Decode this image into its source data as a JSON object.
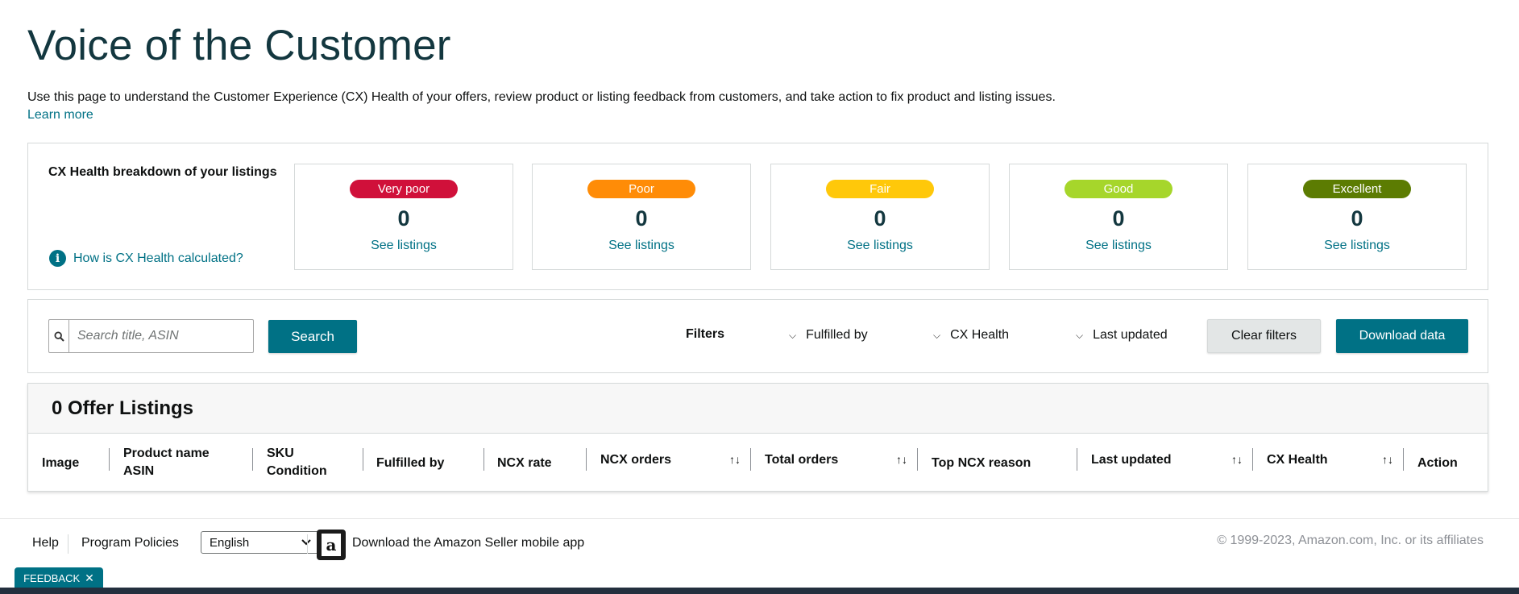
{
  "header": {
    "title": "Voice of the Customer",
    "description": "Use this page to understand the Customer Experience (CX) Health of your offers, review product or listing feedback from customers, and take action to fix product and listing issues.",
    "learn_more": "Learn more"
  },
  "cx_health": {
    "heading": "CX Health breakdown of your listings",
    "how_link": "How is CX Health calculated?",
    "cards": [
      {
        "label": "Very poor",
        "count": "0",
        "link": "See listings",
        "color": "#d0103a"
      },
      {
        "label": "Poor",
        "count": "0",
        "link": "See listings",
        "color": "#ff8c07"
      },
      {
        "label": "Fair",
        "count": "0",
        "link": "See listings",
        "color": "#ffc80a"
      },
      {
        "label": "Good",
        "count": "0",
        "link": "See listings",
        "color": "#a6d62b"
      },
      {
        "label": "Excellent",
        "count": "0",
        "link": "See listings",
        "color": "#5c7c02"
      }
    ]
  },
  "filters": {
    "search_placeholder": "Search title, ASIN",
    "search_button": "Search",
    "label": "Filters",
    "fulfilled_by": "Fulfilled by",
    "cx_health": "CX Health",
    "last_updated": "Last updated",
    "clear_button": "Clear filters",
    "download_button": "Download data"
  },
  "listings": {
    "title": "0 Offer Listings",
    "columns": {
      "image": "Image",
      "product_name": "Product name",
      "asin": "ASIN",
      "sku": "SKU",
      "condition": "Condition",
      "fulfilled_by": "Fulfilled by",
      "ncx_rate": "NCX rate",
      "ncx_orders": "NCX orders",
      "total_orders": "Total orders",
      "top_ncx_reason": "Top NCX reason",
      "last_updated": "Last updated",
      "cx_health": "CX Health",
      "action": "Action"
    }
  },
  "footer": {
    "help": "Help",
    "program_policies": "Program Policies",
    "language": "English",
    "app_link": "Download the Amazon Seller mobile app",
    "copyright": "© 1999-2023, Amazon.com, Inc. or its affiliates",
    "feedback": "FEEDBACK"
  }
}
